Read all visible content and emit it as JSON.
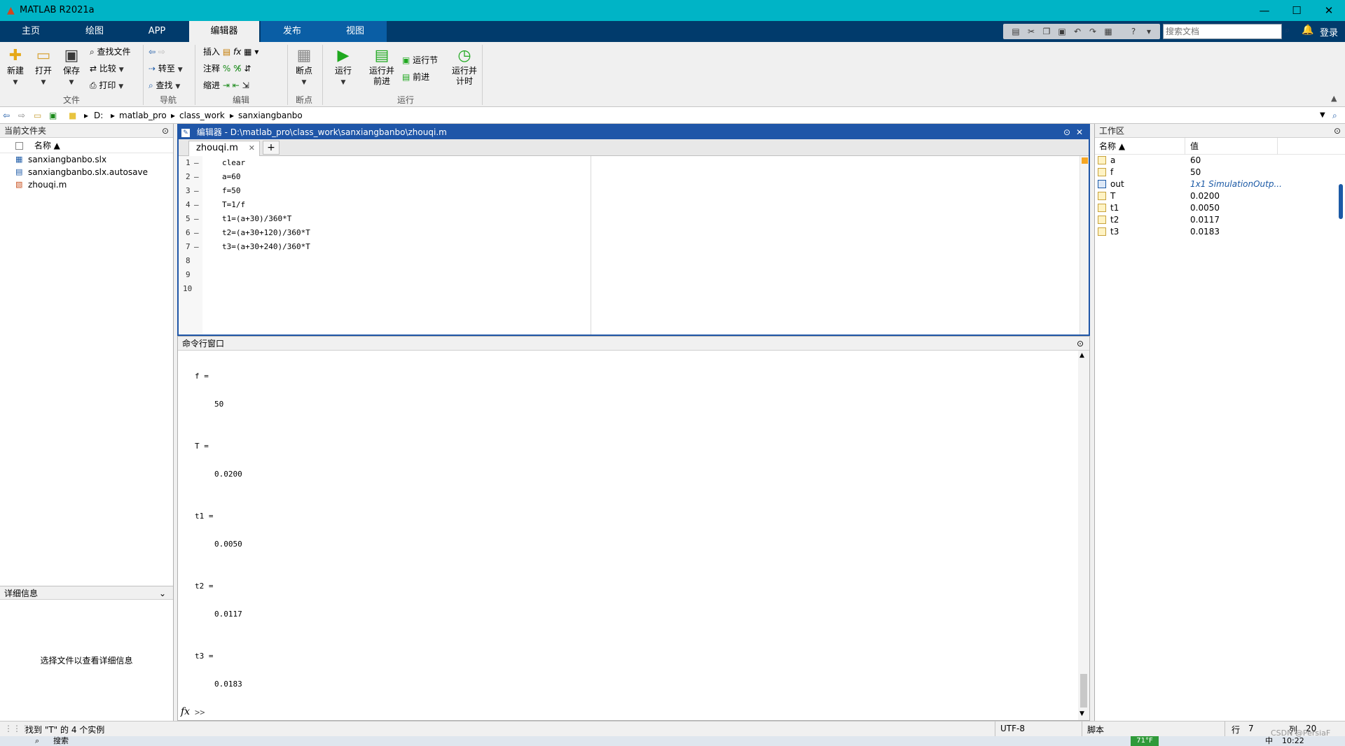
{
  "window": {
    "title": "MATLAB R2021a"
  },
  "tabs": [
    "主页",
    "绘图",
    "APP",
    "编辑器",
    "发布",
    "视图"
  ],
  "search": {
    "placeholder": "搜索文档"
  },
  "login": "登录",
  "ribbon": {
    "file": {
      "new": "新建",
      "open": "打开",
      "save": "保存",
      "find_files": "查找文件",
      "compare": "比较",
      "print": "打印",
      "group": "文件"
    },
    "nav": {
      "goto": "转至",
      "find": "查找",
      "group": "导航"
    },
    "edit": {
      "insert": "插入",
      "comment": "注释",
      "indent": "缩进",
      "group": "编辑"
    },
    "breakpoints": {
      "label": "断点",
      "group": "断点"
    },
    "run": {
      "run": "运行",
      "run_advance_1": "运行并",
      "run_advance_2": "前进",
      "run_section": "运行节",
      "advance": "前进",
      "run_time_1": "运行并",
      "run_time_2": "计时",
      "group": "运行"
    }
  },
  "address": {
    "parts": [
      "D:",
      "matlab_pro",
      "class_work",
      "sanxiangbanbo"
    ]
  },
  "current_folder": {
    "title": "当前文件夹",
    "col_name": "名称 ▲",
    "files": [
      "sanxiangbanbo.slx",
      "sanxiangbanbo.slx.autosave",
      "zhouqi.m"
    ],
    "details_title": "详细信息",
    "details_msg": "选择文件以查看详细信息"
  },
  "editor": {
    "title": "编辑器 - D:\\matlab_pro\\class_work\\sanxiangbanbo\\zhouqi.m",
    "tab": "zhouqi.m",
    "add_tab": "+",
    "lines": [
      "clear",
      "a=60",
      "f=50",
      "T=1/f",
      "t1=(a+30)/360*T",
      "t2=(a+30+120)/360*T",
      "t3=(a+30+240)/360*T",
      "",
      "",
      ""
    ],
    "line_numbers": [
      "1",
      "2",
      "3",
      "4",
      "5",
      "6",
      "7",
      "8",
      "9",
      "10"
    ],
    "dash": "–"
  },
  "command_window": {
    "title": "命令行窗口",
    "output": [
      {
        "name": "f =",
        "value": "50"
      },
      {
        "name": "T =",
        "value": "0.0200"
      },
      {
        "name": "t1 =",
        "value": "0.0050"
      },
      {
        "name": "t2 =",
        "value": "0.0117"
      },
      {
        "name": "t3 =",
        "value": "0.0183"
      }
    ],
    "prompt": ">>",
    "fx": "fx"
  },
  "workspace": {
    "title": "工作区",
    "col_name": "名称 ▲",
    "col_value": "值",
    "vars": [
      {
        "name": "a",
        "value": "60"
      },
      {
        "name": "f",
        "value": "50"
      },
      {
        "name": "out",
        "value": "1x1 SimulationOutp..."
      },
      {
        "name": "T",
        "value": "0.0200"
      },
      {
        "name": "t1",
        "value": "0.0050"
      },
      {
        "name": "t2",
        "value": "0.0117"
      },
      {
        "name": "t3",
        "value": "0.0183"
      }
    ]
  },
  "status": {
    "find_msg": "找到 \"T\" 的 4 个实例",
    "encoding": "UTF-8",
    "type": "脚本",
    "row_label": "行",
    "row": "7",
    "col_label": "列",
    "col": "20"
  },
  "taskbar": {
    "search": "搜索",
    "weather": "71°F",
    "input": "中",
    "time": "10:22",
    "watermark": "CSDN @PersiaF"
  }
}
